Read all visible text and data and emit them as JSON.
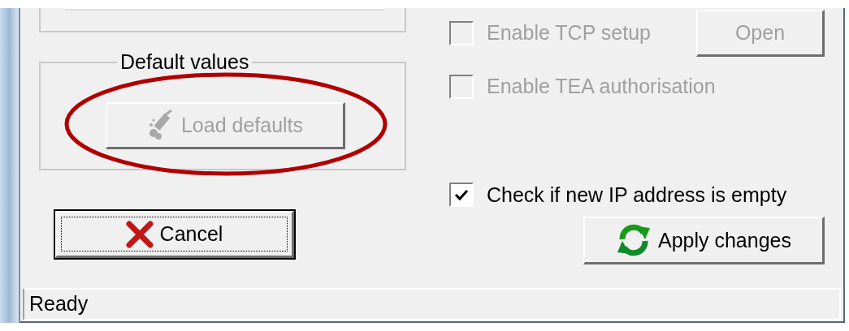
{
  "default_values_group": {
    "title": "Default values",
    "load_button": {
      "label": "Load defaults",
      "disabled": true,
      "focused": false
    }
  },
  "options": [
    {
      "label": "Enable TCP setup",
      "checked": false,
      "disabled": true
    },
    {
      "label": "Enable TEA authorisation",
      "checked": false,
      "disabled": true
    },
    {
      "label": "Check if new IP address is empty",
      "checked": true,
      "disabled": false
    }
  ],
  "open_button": {
    "label": "Open",
    "disabled": true,
    "focused": false
  },
  "cancel_button": {
    "label": "Cancel",
    "disabled": false,
    "focused": true
  },
  "apply_button": {
    "label": "Apply changes",
    "disabled": false,
    "focused": false
  },
  "status_bar": {
    "text": "Ready"
  }
}
